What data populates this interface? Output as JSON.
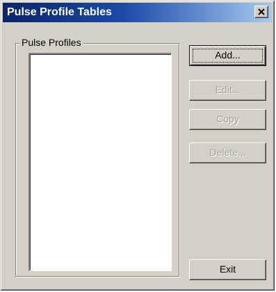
{
  "window": {
    "title": "Pulse Profile Tables",
    "close_icon": "close-icon"
  },
  "group": {
    "label": "Pulse Profiles",
    "items": []
  },
  "buttons": {
    "add": "Add...",
    "edit": "Edit...",
    "copy": "Copy",
    "delete": "Delete...",
    "exit": "Exit"
  },
  "colors": {
    "title_gradient_start": "#0a246a",
    "title_gradient_end": "#a6caf0",
    "face": "#d4d0c8",
    "disabled_text": "#a0a0a0"
  }
}
